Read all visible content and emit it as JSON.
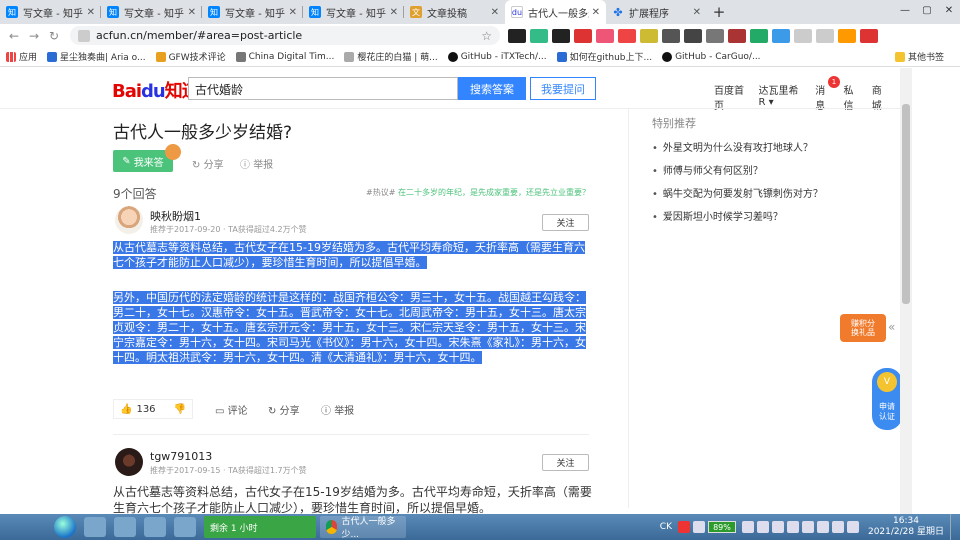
{
  "browser": {
    "tabs": [
      {
        "label": "写文章 - 知乎",
        "favicon": "知",
        "active": false
      },
      {
        "label": "写文章 - 知乎",
        "favicon": "知",
        "active": false
      },
      {
        "label": "写文章 - 知乎",
        "favicon": "知",
        "active": false
      },
      {
        "label": "写文章 - 知乎",
        "favicon": "知",
        "active": false
      },
      {
        "label": "文章投稿",
        "favicon": "文",
        "active": false
      },
      {
        "label": "古代人一般多少岁",
        "favicon": "du",
        "active": true
      },
      {
        "label": "扩展程序",
        "favicon": "puzzle-icon",
        "active": false
      }
    ],
    "new_tab": "+",
    "url": "acfun.cn/member/#area=post-article",
    "bookmarks": [
      {
        "label": "应用"
      },
      {
        "label": "星尘独奏曲| Aria o..."
      },
      {
        "label": "GFW技术评论"
      },
      {
        "label": "China Digital Tim..."
      },
      {
        "label": "樱花庄的白猫 | 萌..."
      },
      {
        "label": "GitHub - iTXTech/..."
      },
      {
        "label": "如何在github上下..."
      },
      {
        "label": "GitHub - CarGuo/..."
      }
    ],
    "bookmarks_other": "其他书签"
  },
  "header": {
    "logo": "Bai",
    "logo_paw": "du",
    "logo_zhidao": "知道",
    "search_value": "古代婚龄",
    "search_button": "搜索答案",
    "ask_button": "我要提问",
    "nav": [
      "百度首页",
      "达瓦里希R ▾",
      "消息",
      "私信",
      "商城"
    ],
    "message_count": "1"
  },
  "question": {
    "title": "古代人一般多少岁结婚?",
    "answer_button": "我来答",
    "share": "分享",
    "report": "举报"
  },
  "answers_header": {
    "count": "9个回答",
    "hot_label": "#热议#",
    "hot_topic": "在二十多岁的年纪，是先成家重要，还是先立业重要？"
  },
  "answer1": {
    "user": "映秋盼烟1",
    "meta": "推荐于2017-09-20 · TA获得超过4.2万个赞",
    "follow": "关注",
    "para1": "从古代墓志等资料总结，古代女子在15-19岁结婚为多。古代平均寿命短，夭折率高（需要生育六七个孩子才能防止人口减少），要珍惜生育时间，所以提倡早婚。",
    "para2": "另外，中国历代的法定婚龄的统计是这样的：战国齐桓公令：男三十，女十五。战国越王勾践令：男二十，女十七。汉惠帝令：女十五。晋武帝令：女十七。北周武帝令：男十五，女十三。唐太宗贞观令：男二十，女十五。唐玄宗开元令：男十五，女十三。宋仁宗天圣令：男十五，女十三。宋宁宗嘉定令：男十六，女十四。宋司马光《书仪》：男十六，女十四。宋朱熹《家礼》：男十六，女十四。明太祖洪武令：男十六，女十四。清《大清通礼》：男十六，女十四。",
    "votes": "136",
    "comment": "评论",
    "share": "分享",
    "report": "举报"
  },
  "answer2": {
    "user": "tgw791013",
    "meta": "推荐于2017-09-15 · TA获得超过1.7万个赞",
    "follow": "关注",
    "para1": "从古代墓志等资料总结，古代女子在15-19岁结婚为多。古代平均寿命短，夭折率高（需要生育六七个孩子才能防止人口减少），要珍惜生育时间，所以提倡早婚。"
  },
  "sidebar": {
    "title": "特别推荐",
    "items": [
      "外星文明为什么没有攻打地球人？",
      "师傅与师父有何区别？",
      "蜗牛交配为何要发射飞镖刺伤对方？",
      "爱因斯坦小时候学习差吗？"
    ]
  },
  "promos": {
    "points": "赚积分\n换礼品",
    "apply": "申请\n认证",
    "apply_badge": "V"
  },
  "taskbar": {
    "task_timer": "剩余 1 小时",
    "task_chrome": "古代人一般多少...",
    "tray_lang": "CK",
    "battery": "89%",
    "time": "16:34",
    "date": "2021/2/28 星期日"
  }
}
